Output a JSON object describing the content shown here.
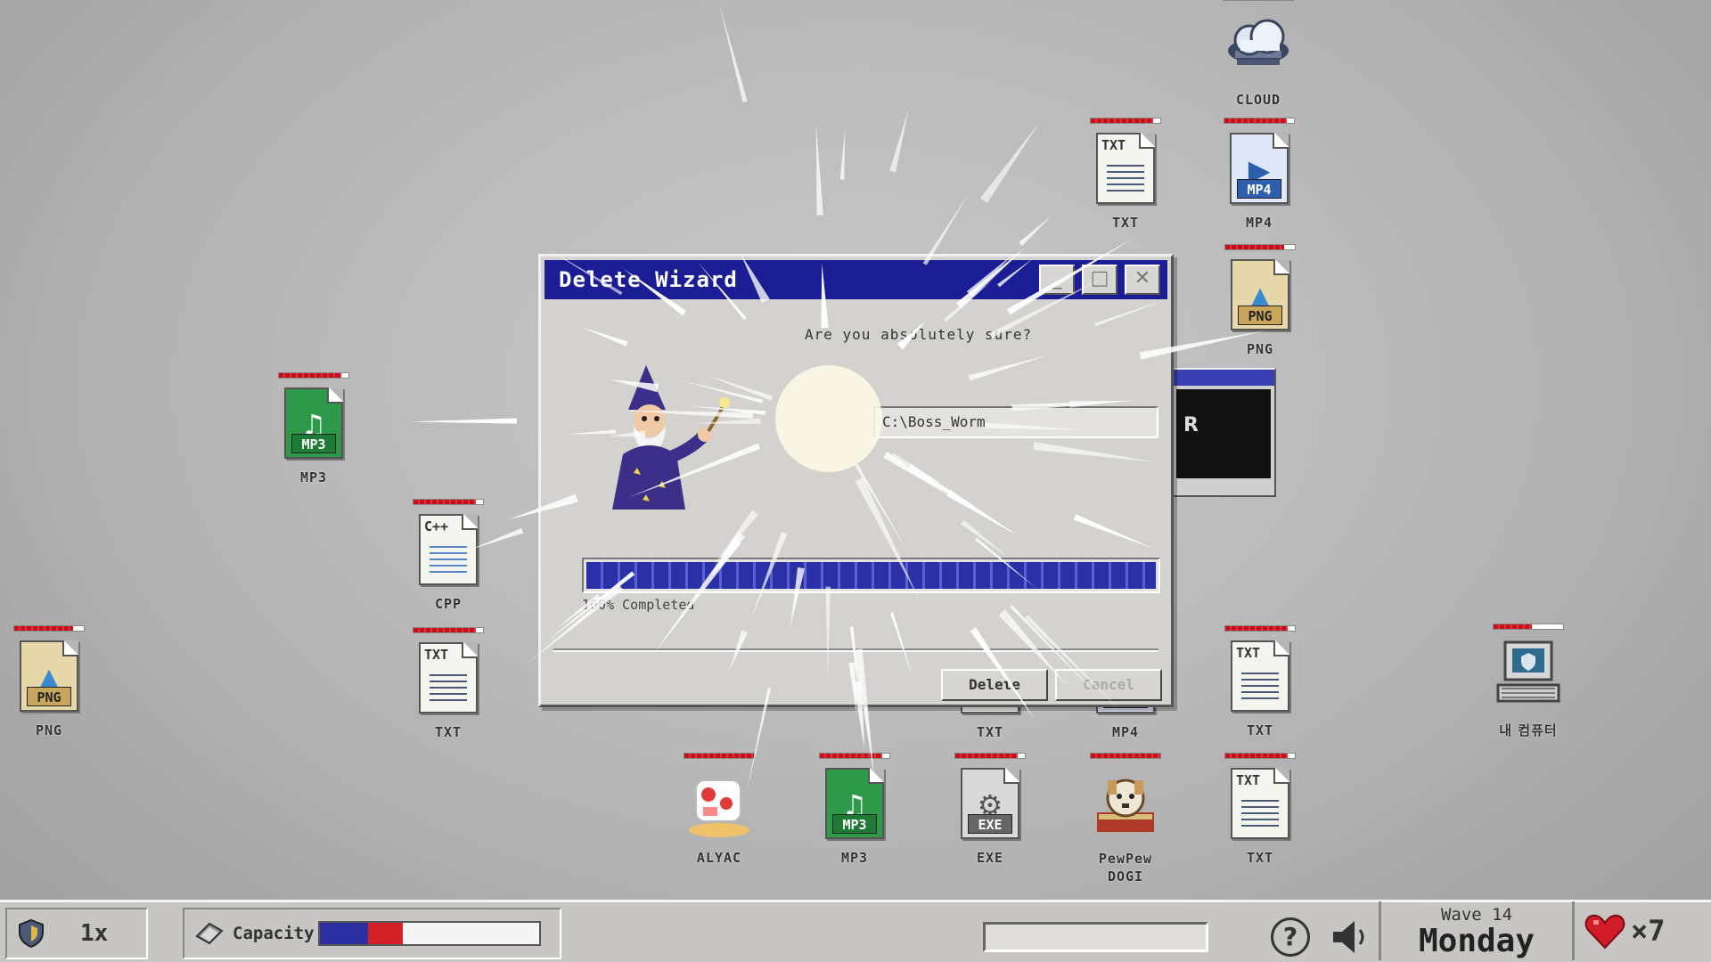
{
  "desktop_icons": [
    {
      "id": "cloud",
      "label": "CLOUD",
      "kind": "cloud",
      "hp": 1.0
    },
    {
      "id": "txt-top",
      "label": "TXT",
      "kind": "txt",
      "hp": 0.9
    },
    {
      "id": "mp4-top",
      "label": "MP4",
      "kind": "mp4",
      "hp": 0.9
    },
    {
      "id": "png-right",
      "label": "PNG",
      "kind": "png",
      "hp": 0.85
    },
    {
      "id": "mp3-left",
      "label": "MP3",
      "kind": "mp3",
      "hp": 0.9
    },
    {
      "id": "cpp",
      "label": "CPP",
      "kind": "cpp",
      "hp": 0.9
    },
    {
      "id": "png-left",
      "label": "PNG",
      "kind": "png",
      "hp": 0.85
    },
    {
      "id": "txt-left",
      "label": "TXT",
      "kind": "txt",
      "hp": 0.9
    },
    {
      "id": "txt-under",
      "label": "TXT",
      "kind": "txt",
      "hp": 0.9
    },
    {
      "id": "mp4-under",
      "label": "MP4",
      "kind": "mp4",
      "hp": 0.9
    },
    {
      "id": "txt-right",
      "label": "TXT",
      "kind": "txt",
      "hp": 0.9
    },
    {
      "id": "my-computer",
      "label": "내 컴퓨터",
      "kind": "computer",
      "hp": 0.55
    },
    {
      "id": "alyac",
      "label": "ALYAC",
      "kind": "alyac",
      "hp": 1.0
    },
    {
      "id": "mp3-bottom",
      "label": "MP3",
      "kind": "mp3",
      "hp": 0.9
    },
    {
      "id": "exe",
      "label": "EXE",
      "kind": "exe",
      "hp": 0.9
    },
    {
      "id": "pewpew",
      "label": "PewPew DOGI",
      "kind": "dogi",
      "hp": 1.0
    },
    {
      "id": "txt-bottom-right",
      "label": "TXT",
      "kind": "txt",
      "hp": 0.9
    }
  ],
  "dialog": {
    "title": "Delete Wizard",
    "question": "Are you absolutely sure?",
    "path": "C:\\Boss_Worm",
    "progress": 1.0,
    "progress_label": "100% Completed",
    "delete_label": "Delete",
    "cancel_label": "Cancel",
    "minimize_glyph": "_",
    "maximize_glyph": "□",
    "close_glyph": "✕"
  },
  "mini_window": {
    "screen_text": "R"
  },
  "taskbar": {
    "speed": "1x",
    "capacity_label": "Capacity",
    "capacity_blue": 0.22,
    "capacity_red": 0.16,
    "help_glyph": "?",
    "wave": "Wave 14",
    "day": "Monday",
    "lives": "×7"
  },
  "colors": {
    "title_bar": "#1a1d93",
    "progress": "#2a30a8",
    "hp": "#c4101a",
    "capacity_blue": "#2b2fa0",
    "capacity_red": "#d42027",
    "heart": "#d21c2a"
  }
}
